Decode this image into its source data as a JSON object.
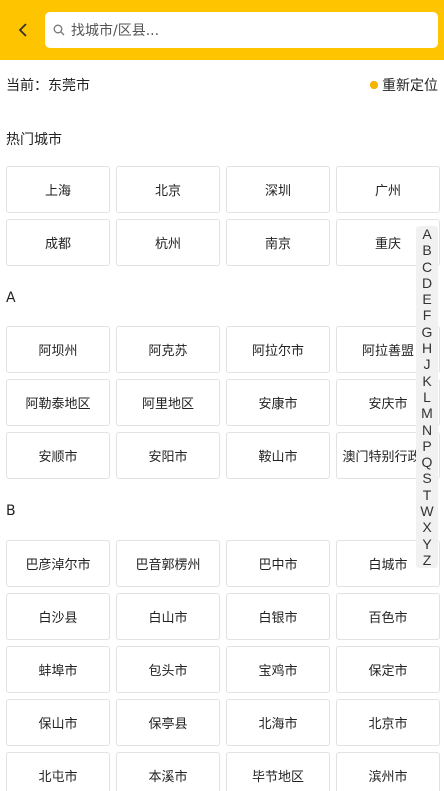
{
  "header": {
    "search_placeholder": "找城市/区县..."
  },
  "location": {
    "current_label": "当前：东莞市",
    "relocate_label": "重新定位"
  },
  "hot": {
    "title": "热门城市",
    "cities": [
      "上海",
      "北京",
      "深圳",
      "广州",
      "成都",
      "杭州",
      "南京",
      "重庆"
    ]
  },
  "section_a": {
    "title": "A",
    "cities": [
      "阿坝州",
      "阿克苏",
      "阿拉尔市",
      "阿拉善盟",
      "阿勒泰地区",
      "阿里地区",
      "安康市",
      "安庆市",
      "安顺市",
      "安阳市",
      "鞍山市",
      "澳门特别行政区"
    ]
  },
  "section_b": {
    "title": "B",
    "cities": [
      "巴彦淖尔市",
      "巴音郭楞州",
      "巴中市",
      "白城市",
      "白沙县",
      "白山市",
      "白银市",
      "百色市",
      "蚌埠市",
      "包头市",
      "宝鸡市",
      "保定市",
      "保山市",
      "保亭县",
      "北海市",
      "北京市",
      "北屯市",
      "本溪市",
      "毕节地区",
      "滨州市"
    ]
  },
  "index_letters": [
    "A",
    "B",
    "C",
    "D",
    "E",
    "F",
    "G",
    "H",
    "J",
    "K",
    "L",
    "M",
    "N",
    "P",
    "Q",
    "S",
    "T",
    "W",
    "X",
    "Y",
    "Z"
  ]
}
